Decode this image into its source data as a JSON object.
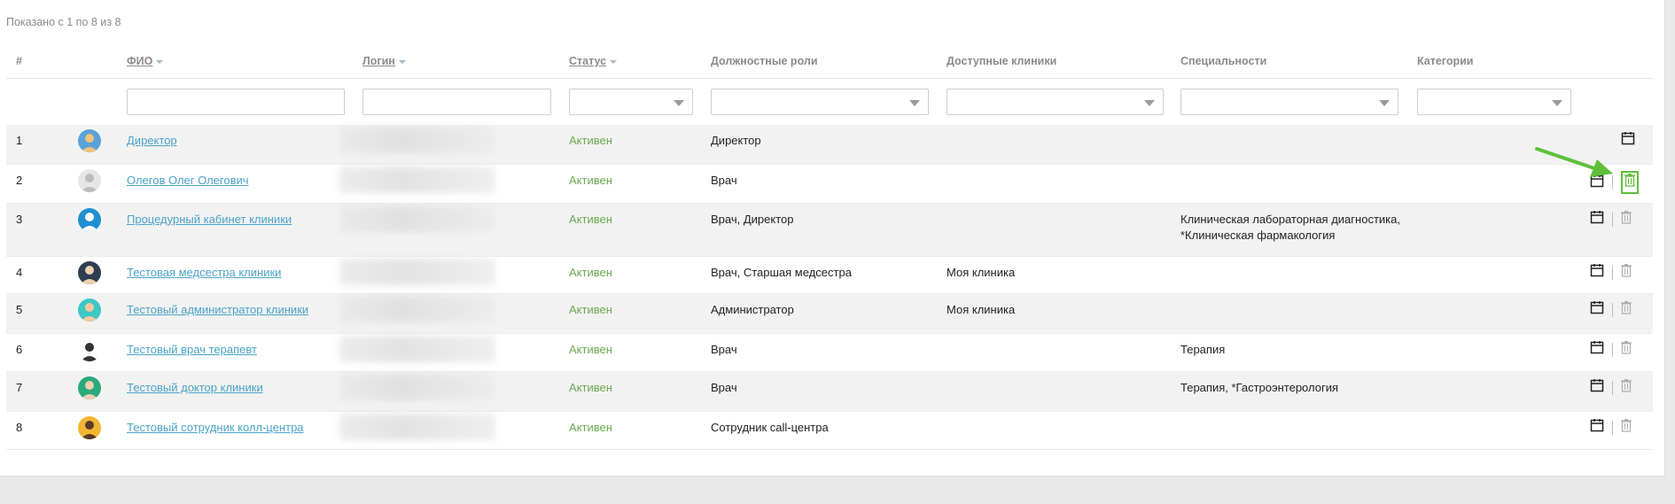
{
  "summary": "Показано с 1 по 8 из 8",
  "headers": {
    "num": "#",
    "fio": "ФИО",
    "login": "Логин",
    "status": "Статус",
    "roles": "Должностные роли",
    "clinics": "Доступные клиники",
    "specialties": "Специальности",
    "categories": "Категории"
  },
  "rows": [
    {
      "num": "1",
      "fio": "Директор",
      "status": "Активен",
      "roles": "Директор",
      "clinics": "",
      "spec1": "",
      "spec2": "",
      "avatar": "director-avatar-icon"
    },
    {
      "num": "2",
      "fio": "Олегов Олег Олегович",
      "status": "Активен",
      "roles": "Врач",
      "clinics": "",
      "spec1": "",
      "spec2": "",
      "avatar": "default-user-avatar-icon"
    },
    {
      "num": "3",
      "fio": "Процедурный кабинет клиники",
      "status": "Активен",
      "roles": "Врач, Директор",
      "clinics": "",
      "spec1": "Клиническая лабораторная диагностика,",
      "spec2": "*Клиническая фармакология",
      "avatar": "syringe-avatar-icon"
    },
    {
      "num": "4",
      "fio": "Тестовая медсестра клиники",
      "status": "Активен",
      "roles": "Врач, Старшая медсестра",
      "clinics": "Моя клиника",
      "spec1": "",
      "spec2": "",
      "avatar": "nurse-avatar-icon"
    },
    {
      "num": "5",
      "fio": "Тестовый администратор клиники",
      "status": "Активен",
      "roles": "Администратор",
      "clinics": "Моя клиника",
      "spec1": "",
      "spec2": "",
      "avatar": "admin-avatar-icon"
    },
    {
      "num": "6",
      "fio": "Тестовый врач терапевт",
      "status": "Активен",
      "roles": "Врач",
      "clinics": "",
      "spec1": "Терапия",
      "spec2": "",
      "avatar": "therapist-avatar-icon"
    },
    {
      "num": "7",
      "fio": "Тестовый доктор клиники",
      "status": "Активен",
      "roles": "Врач",
      "clinics": "",
      "spec1": "Терапия, *Гастроэнтерология",
      "spec2": "",
      "avatar": "doctor-avatar-icon"
    },
    {
      "num": "8",
      "fio": "Тестовый сотрудник колл-центра",
      "status": "Активен",
      "roles": "Сотрудник call-центра",
      "clinics": "",
      "spec1": "",
      "spec2": "",
      "avatar": "callcenter-avatar-icon"
    }
  ],
  "colors": {
    "link": "#4aa3c8",
    "status_active": "#6aa84f",
    "annotation_arrow": "#5fbf3a"
  },
  "icons": {
    "schedule": "calendar-icon",
    "delete": "trash-icon"
  }
}
